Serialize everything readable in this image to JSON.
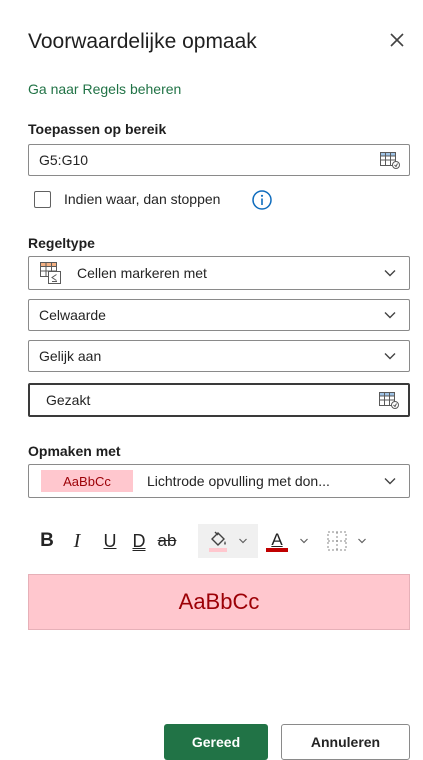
{
  "panel": {
    "title": "Voorwaardelijke opmaak",
    "manage_rules_link": "Ga naar Regels beheren"
  },
  "apply_range": {
    "heading": "Toepassen op bereik",
    "value": "G5:G10",
    "stop_if_true_label": "Indien waar, dan stoppen",
    "stop_if_true_checked": false
  },
  "rule_type": {
    "heading": "Regeltype",
    "type_value": "Cellen markeren met",
    "condition_value": "Celwaarde",
    "operator_value": "Gelijk aan",
    "criteria_value": "Gezakt"
  },
  "format_with": {
    "heading": "Opmaken met",
    "sample_text": "AaBbCc",
    "style_value": "Lichtrode opvulling met don..."
  },
  "toolbar": {
    "bold": "B",
    "italic": "I",
    "underline": "U",
    "double_underline": "D",
    "strikethrough": "ab",
    "font_color_letter": "A"
  },
  "preview": {
    "text": "AaBbCc"
  },
  "footer": {
    "done_label": "Gereed",
    "cancel_label": "Annuleren"
  },
  "colors": {
    "accent_green": "#217346",
    "preview_fill": "#ffc7ce",
    "preview_text": "#9c0006",
    "font_color_bar": "#c00000",
    "fill_color_bar": "#ffc7ce",
    "info_blue": "#0f6cbd"
  },
  "icons": {
    "close": "close-icon",
    "range_picker": "range-picker-icon",
    "info": "info-icon",
    "rule_type": "highlight-cells-icon",
    "dropdown": "chevron-down-icon",
    "fill_color": "paint-bucket-icon",
    "borders": "borders-icon"
  }
}
